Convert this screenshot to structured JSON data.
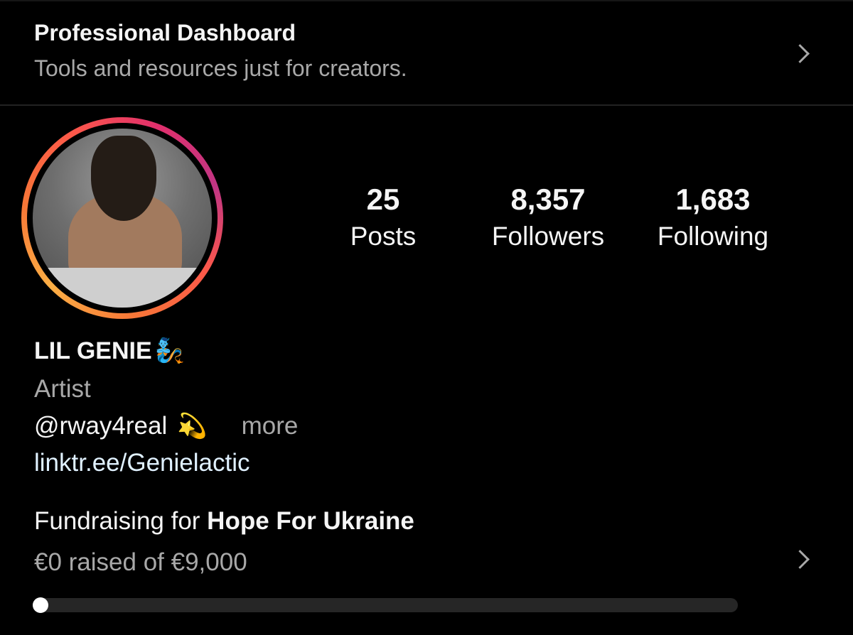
{
  "dashboard": {
    "title": "Professional Dashboard",
    "subtitle": "Tools and resources just for creators.",
    "chevron_icon": "chevron-right-icon"
  },
  "profile": {
    "avatar_icon": "profile-photo",
    "name": "LIL GENIE",
    "name_emoji": "🧞",
    "category": "Artist",
    "bio_handle": "@rway4real",
    "bio_emoji": "💫",
    "more_label": "more",
    "link": "linktr.ee/Genielactic"
  },
  "stats": {
    "posts": {
      "count": "25",
      "label": "Posts"
    },
    "followers": {
      "count": "8,357",
      "label": "Followers"
    },
    "following": {
      "count": "1,683",
      "label": "Following"
    }
  },
  "fundraiser": {
    "prefix": "Fundraising for ",
    "cause": "Hope For Ukraine",
    "raised_text": "€0 raised of €9,000",
    "progress_fraction": 0.0
  },
  "colors": {
    "background": "#000000",
    "secondary_text": "#a8a8a8",
    "link_text": "#e0f1ff",
    "ring_start": "#e1306c",
    "ring_end": "#fcaf45"
  }
}
